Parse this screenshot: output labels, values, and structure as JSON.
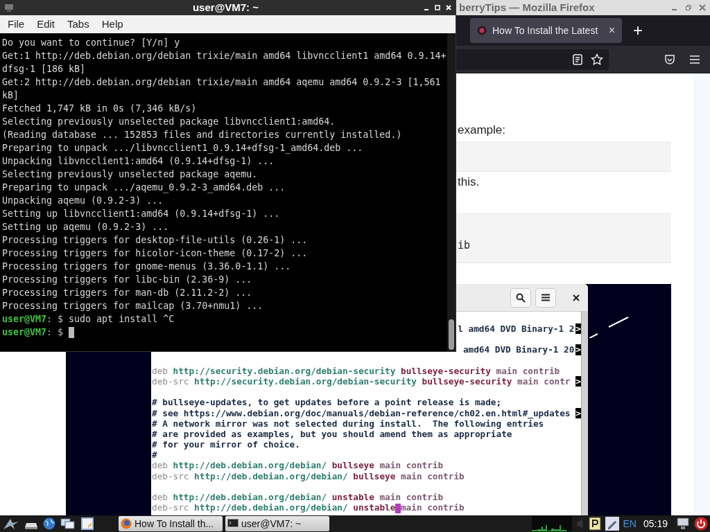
{
  "terminal": {
    "title": "user@VM7: ~",
    "menu": [
      "File",
      "Edit",
      "Tabs",
      "Help"
    ],
    "lines": [
      {
        "kind": "output",
        "text": "Do you want to continue? [Y/n] y"
      },
      {
        "kind": "output",
        "text": "Get:1 http://deb.debian.org/debian trixie/main amd64 libvncclient1 amd64 0.9.14+"
      },
      {
        "kind": "output",
        "text": "dfsg-1 [186 kB]"
      },
      {
        "kind": "output",
        "text": "Get:2 http://deb.debian.org/debian trixie/main amd64 aqemu amd64 0.9.2-3 [1,561"
      },
      {
        "kind": "output",
        "text": "kB]"
      },
      {
        "kind": "output",
        "text": "Fetched 1,747 kB in 0s (7,346 kB/s)"
      },
      {
        "kind": "output",
        "text": "Selecting previously unselected package libvncclient1:amd64."
      },
      {
        "kind": "output",
        "text": "(Reading database ... 152853 files and directories currently installed.)"
      },
      {
        "kind": "output",
        "text": "Preparing to unpack .../libvncclient1_0.9.14+dfsg-1_amd64.deb ..."
      },
      {
        "kind": "output",
        "text": "Unpacking libvncclient1:amd64 (0.9.14+dfsg-1) ..."
      },
      {
        "kind": "output",
        "text": "Selecting previously unselected package aqemu."
      },
      {
        "kind": "output",
        "text": "Preparing to unpack .../aqemu_0.9.2-3_amd64.deb ..."
      },
      {
        "kind": "output",
        "text": "Unpacking aqemu (0.9.2-3) ..."
      },
      {
        "kind": "output",
        "text": "Setting up libvncclient1:amd64 (0.9.14+dfsg-1) ..."
      },
      {
        "kind": "output",
        "text": "Setting up aqemu (0.9.2-3) ..."
      },
      {
        "kind": "output",
        "text": "Processing triggers for desktop-file-utils (0.26-1) ..."
      },
      {
        "kind": "output",
        "text": "Processing triggers for hicolor-icon-theme (0.17-2) ..."
      },
      {
        "kind": "output",
        "text": "Processing triggers for gnome-menus (3.36.0-1.1) ..."
      },
      {
        "kind": "output",
        "text": "Processing triggers for libc-bin (2.36-9) ..."
      },
      {
        "kind": "output",
        "text": "Processing triggers for man-db (2.11.2-2) ..."
      },
      {
        "kind": "output",
        "text": "Processing triggers for mailcap (3.70+nmu1) ..."
      },
      {
        "kind": "prompt",
        "user": "user@VM7",
        "symbol": ": $",
        "command": "sudo apt install ^C"
      },
      {
        "kind": "prompt",
        "user": "user@VM7",
        "symbol": ": $",
        "cursor": true
      }
    ]
  },
  "browser": {
    "title": "berryTips — Mozilla Firefox",
    "tab": {
      "title": "How To Install the Latest",
      "close": "×"
    },
    "new_tab": "+",
    "page": {
      "blocks": [
        {
          "kind": "text",
          "text": "example:"
        },
        {
          "kind": "code"
        },
        {
          "kind": "text",
          "text": "this."
        },
        {
          "kind": "code",
          "text": "ib"
        }
      ],
      "screenshot": {
        "editor": {
          "lines": [
            {
              "kind": "clipped",
              "segments": [
                {
                  "kind": "comment",
                  "text": "l amd64 DVD Binary-1 2"
                }
              ],
              "more": ">"
            },
            {
              "kind": "blank"
            },
            {
              "kind": "clipped",
              "segments": [
                {
                  "kind": "comment",
                  "text": "amd64 DVD Binary-1 20"
                }
              ],
              "more": ">"
            },
            {
              "kind": "blank"
            },
            {
              "kind": "code",
              "segments": [
                {
                  "kind": "keyword",
                  "text": "deb "
                },
                {
                  "kind": "url",
                  "text": "http://security.debian.org/debian-security "
                },
                {
                  "kind": "suite",
                  "text": "bullseye-security "
                },
                {
                  "kind": "component",
                  "text": "main contrib"
                }
              ]
            },
            {
              "kind": "code",
              "segments": [
                {
                  "kind": "keyword",
                  "text": "deb-src "
                },
                {
                  "kind": "url",
                  "text": "http://security.debian.org/debian-security "
                },
                {
                  "kind": "suite",
                  "text": "bullseye-security "
                },
                {
                  "kind": "component",
                  "text": "main contr"
                }
              ],
              "more": ">"
            },
            {
              "kind": "blank"
            },
            {
              "kind": "code",
              "segments": [
                {
                  "kind": "comment",
                  "text": "# bullseye-updates, to get updates before a point release is made;"
                }
              ]
            },
            {
              "kind": "code",
              "segments": [
                {
                  "kind": "comment",
                  "text": "# see https://www.debian.org/doc/manuals/debian-reference/ch02.en.html#_updates"
                }
              ],
              "more": ">"
            },
            {
              "kind": "code",
              "segments": [
                {
                  "kind": "comment",
                  "text": "# A network mirror was not selected during install.  The following entries"
                }
              ]
            },
            {
              "kind": "code",
              "segments": [
                {
                  "kind": "comment",
                  "text": "# are provided as examples, but you should amend them as appropriate"
                }
              ]
            },
            {
              "kind": "code",
              "segments": [
                {
                  "kind": "comment",
                  "text": "# for your mirror of choice."
                }
              ]
            },
            {
              "kind": "code",
              "segments": [
                {
                  "kind": "comment",
                  "text": "#"
                }
              ]
            },
            {
              "kind": "code",
              "segments": [
                {
                  "kind": "keyword",
                  "text": "deb "
                },
                {
                  "kind": "url",
                  "text": "http://deb.debian.org/debian/ "
                },
                {
                  "kind": "suite",
                  "text": "bullseye "
                },
                {
                  "kind": "component",
                  "text": "main contrib"
                }
              ]
            },
            {
              "kind": "code",
              "segments": [
                {
                  "kind": "keyword",
                  "text": "deb-src "
                },
                {
                  "kind": "url",
                  "text": "http://deb.debian.org/debian/ "
                },
                {
                  "kind": "suite",
                  "text": "bullseye "
                },
                {
                  "kind": "component",
                  "text": "main contrib"
                }
              ]
            },
            {
              "kind": "blank"
            },
            {
              "kind": "code",
              "segments": [
                {
                  "kind": "keyword",
                  "text": "deb "
                },
                {
                  "kind": "url",
                  "text": "http://deb.debian.org/debian/ "
                },
                {
                  "kind": "suite",
                  "text": "unstable "
                },
                {
                  "kind": "component",
                  "text": "main contrib"
                }
              ]
            },
            {
              "kind": "code",
              "segments": [
                {
                  "kind": "keyword",
                  "text": "deb-src "
                },
                {
                  "kind": "url",
                  "text": "http://deb.debian.org/debian/ "
                },
                {
                  "kind": "suite",
                  "text": "unstable"
                },
                {
                  "kind": "cursor"
                },
                {
                  "kind": "component",
                  "text": "main contrib"
                }
              ]
            }
          ]
        }
      }
    }
  },
  "taskbar": {
    "tasks": [
      {
        "kind": "browser",
        "title": "How To Install th..."
      },
      {
        "kind": "terminal",
        "title": "user@VM7: ~"
      }
    ],
    "language": "EN",
    "clock": "05:19"
  }
}
